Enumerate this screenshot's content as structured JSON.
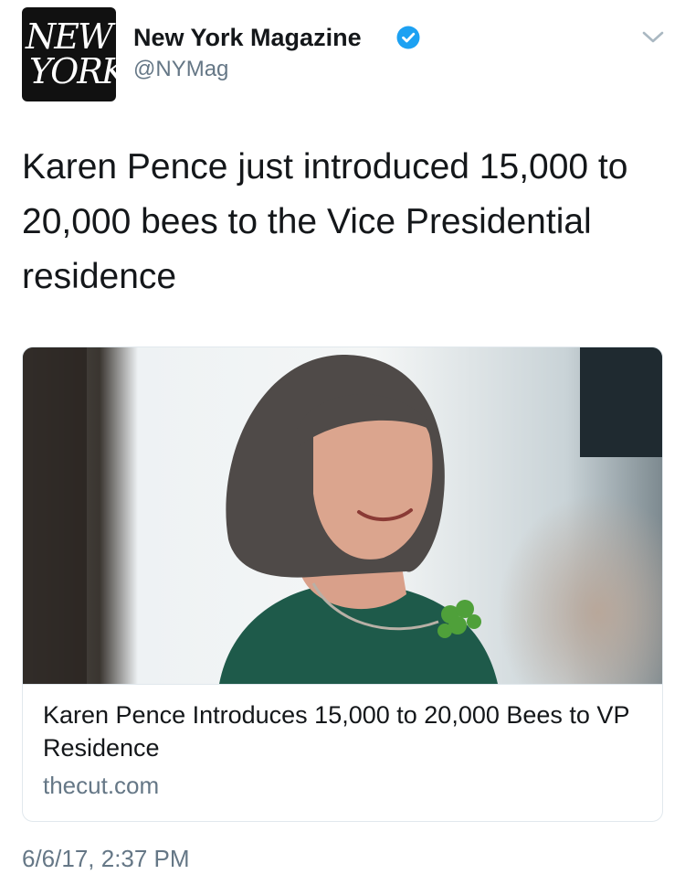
{
  "account": {
    "display_name": "New York Magazine",
    "handle": "@NYMag",
    "avatar_text_line1": "NEW",
    "avatar_text_line2": "YORK",
    "verified": true
  },
  "tweet": {
    "text": "Karen Pence just introduced 15,000 to 20,000 bees to the Vice Presidential residence",
    "timestamp": "6/6/17, 2:37 PM"
  },
  "card": {
    "title": "Karen Pence Introduces 15,000 to 20,000 Bees to VP Residence",
    "domain": "thecut.com"
  },
  "colors": {
    "verified_blue": "#1da1f2",
    "secondary_text": "#657786",
    "card_border": "#e1e8ed"
  },
  "icons": {
    "verified": "verified-badge-icon",
    "menu": "chevron-down-icon"
  }
}
